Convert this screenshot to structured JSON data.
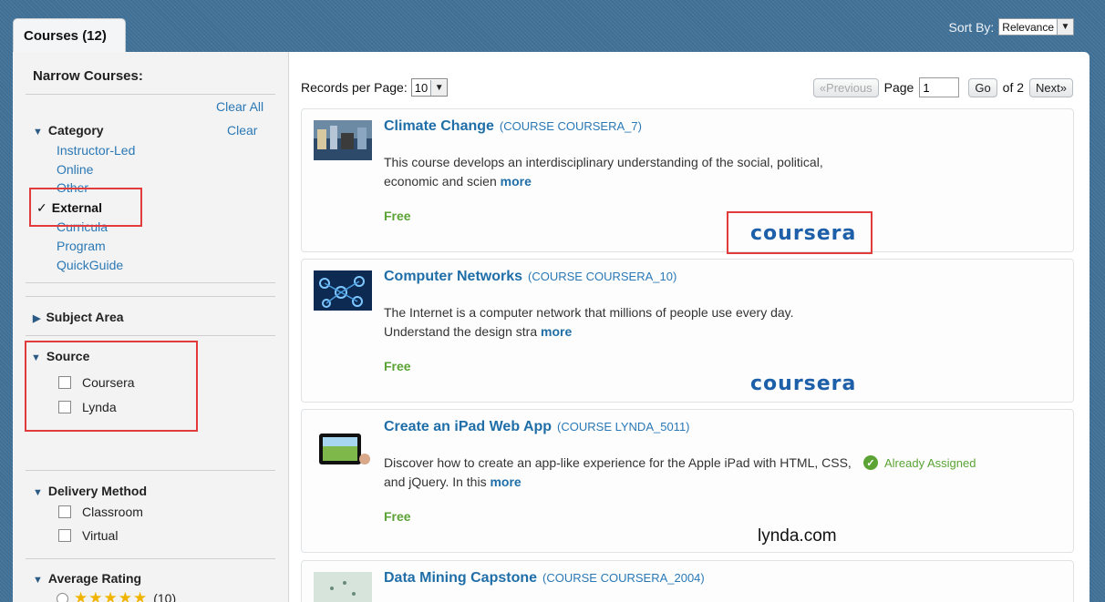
{
  "header": {
    "tab_label": "Courses (12)",
    "sort_label": "Sort By:",
    "sort_value": "Relevance"
  },
  "sidebar": {
    "title": "Narrow Courses:",
    "clear_all": "Clear All",
    "category": {
      "label": "Category",
      "clear": "Clear",
      "items": [
        "Instructor-Led",
        "Online",
        "Other",
        "External",
        "Curricula",
        "Program",
        "QuickGuide"
      ],
      "checked_item": "External",
      "checkmark": "✓"
    },
    "subject_area": {
      "label": "Subject Area"
    },
    "source": {
      "label": "Source",
      "options": [
        "Coursera",
        "Lynda"
      ]
    },
    "delivery_method": {
      "label": "Delivery Method",
      "options": [
        "Classroom",
        "Virtual"
      ]
    },
    "average_rating": {
      "label": "Average Rating",
      "stars": "★★★★★",
      "count": "(10)"
    }
  },
  "toolbar": {
    "records_label": "Records per Page:",
    "records_value": "10",
    "prev_label": "«Previous",
    "page_label": "Page",
    "page_value": "1",
    "go_label": "Go",
    "of_label": "of 2",
    "next_label": "Next»"
  },
  "courses": [
    {
      "title": "Climate Change",
      "code": "(COURSE COURSERA_7)",
      "description": "This course develops an interdisciplinary understanding of the social, political, economic and scien",
      "more": "more",
      "price": "Free",
      "provider": "coursera"
    },
    {
      "title": "Computer Networks",
      "code": "(COURSE COURSERA_10)",
      "description": "The Internet is a computer network that millions of people use every day. Understand the design stra",
      "more": "more",
      "price": "Free",
      "provider": "coursera"
    },
    {
      "title": "Create an iPad Web App",
      "code": "(COURSE LYNDA_5011)",
      "description": "Discover how to create an app-like experience for the Apple iPad with HTML, CSS, and jQuery. In this",
      "more": "more",
      "price": "Free",
      "provider": "lynda.com",
      "status": "Already Assigned"
    },
    {
      "title": "Data Mining Capstone",
      "code": "(COURSE COURSERA_2004)"
    }
  ],
  "colors": {
    "link_blue": "#1f6ea8",
    "free_green": "#5aa334",
    "highlight_red": "#e23b3b",
    "background": "#3f6f95"
  }
}
